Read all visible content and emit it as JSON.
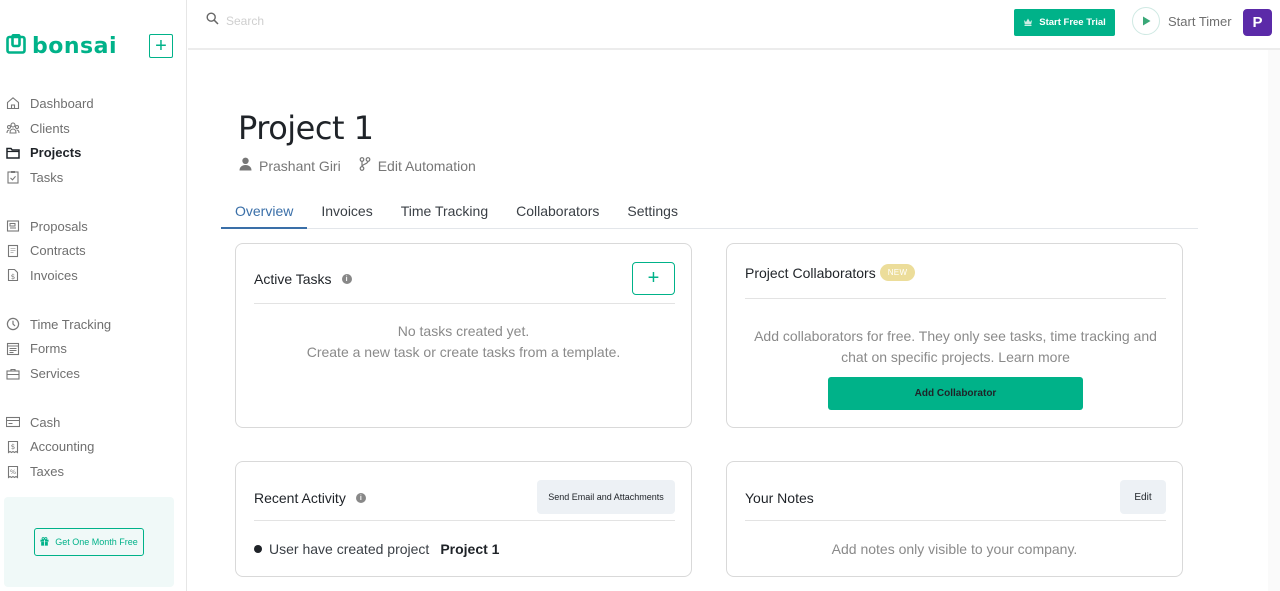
{
  "brand": {
    "name": "bonsai",
    "accent": "#00b289",
    "logo_icon": "bonsai-logo-icon",
    "new_icon": "plus-icon"
  },
  "sidebar": {
    "groups": [
      [
        {
          "label": "Dashboard",
          "icon": "home-icon",
          "active": false
        },
        {
          "label": "Clients",
          "icon": "users-icon",
          "active": false
        },
        {
          "label": "Projects",
          "icon": "folder-icon",
          "active": true
        },
        {
          "label": "Tasks",
          "icon": "clipboard-check-icon",
          "active": false
        }
      ],
      [
        {
          "label": "Proposals",
          "icon": "proposal-icon",
          "active": false
        },
        {
          "label": "Contracts",
          "icon": "document-icon",
          "active": false
        },
        {
          "label": "Invoices",
          "icon": "invoice-icon",
          "active": false
        }
      ],
      [
        {
          "label": "Time Tracking",
          "icon": "clock-icon",
          "active": false
        },
        {
          "label": "Forms",
          "icon": "form-icon",
          "active": false
        },
        {
          "label": "Services",
          "icon": "briefcase-icon",
          "active": false
        }
      ],
      [
        {
          "label": "Cash",
          "icon": "credit-card-icon",
          "active": false
        },
        {
          "label": "Accounting",
          "icon": "receipt-dollar-icon",
          "active": false
        },
        {
          "label": "Taxes",
          "icon": "receipt-percent-icon",
          "active": false
        }
      ]
    ],
    "promo": {
      "label": "Get One Month Free",
      "icon": "gift-icon"
    }
  },
  "topbar": {
    "search_placeholder": "Search",
    "trial_button": "Start Free Trial",
    "timer_label": "Start Timer",
    "avatar_initial": "P",
    "avatar_color": "#5b2aa8"
  },
  "project": {
    "title": "Project 1",
    "owner": "Prashant Giri",
    "automation": "Edit Automation",
    "tabs": [
      "Overview",
      "Invoices",
      "Time Tracking",
      "Collaborators",
      "Settings"
    ],
    "active_tab": "Overview"
  },
  "cards": {
    "active_tasks": {
      "title": "Active Tasks",
      "empty_line1": "No tasks created yet.",
      "empty_line2": "Create a new task or create tasks from a template."
    },
    "collaborators": {
      "title": "Project Collaborators",
      "badge": "NEW",
      "description": "Add collaborators for free. They only see tasks, time tracking and chat on specific projects. Learn more",
      "button": "Add Collaborator"
    },
    "recent_activity": {
      "title": "Recent Activity",
      "button": "Send Email and Attachments",
      "items": [
        {
          "text": "User have created project",
          "project": "Project 1"
        }
      ]
    },
    "notes": {
      "title": "Your Notes",
      "button": "Edit",
      "empty": "Add notes only visible to your company."
    }
  }
}
